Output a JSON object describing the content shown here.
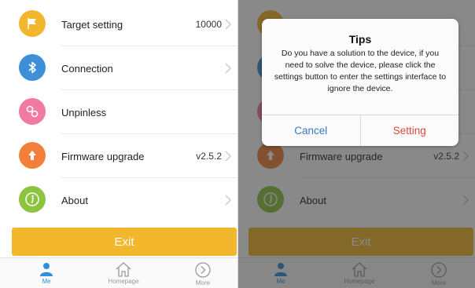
{
  "menu": {
    "target_setting": {
      "label": "Target setting",
      "value": "10000"
    },
    "connection": {
      "label": "Connection"
    },
    "unpinless": {
      "label": "Unpinless"
    },
    "firmware_upgrade": {
      "label": "Firmware upgrade",
      "value": "v2.5.2"
    },
    "about": {
      "label": "About"
    }
  },
  "exit_label": "Exit",
  "tabbar": {
    "me": "Me",
    "homepage": "Homepage",
    "more": "More"
  },
  "dialog": {
    "title": "Tips",
    "message": "Do you have a solution to the device, if you need to solve the device, please click the settings button to enter the settings interface to ignore the device.",
    "cancel": "Cancel",
    "setting": "Setting"
  },
  "colors": {
    "target_icon": "#f3b72e",
    "connection_icon": "#3d8fd8",
    "unpinless_icon": "#f07aa0",
    "firmware_icon": "#f2803a",
    "about_icon": "#8cc43f",
    "exit_button": "#f3b72e",
    "tab_active": "#2f8fd8",
    "cancel_text": "#3a78c6",
    "setting_text": "#e0473a"
  },
  "icons": [
    "flag-icon",
    "bluetooth-icon",
    "link-icon",
    "upload-arrow-icon",
    "info-icon",
    "person-icon",
    "home-icon",
    "chevron-circle-icon",
    "chevron-right-icon"
  ]
}
